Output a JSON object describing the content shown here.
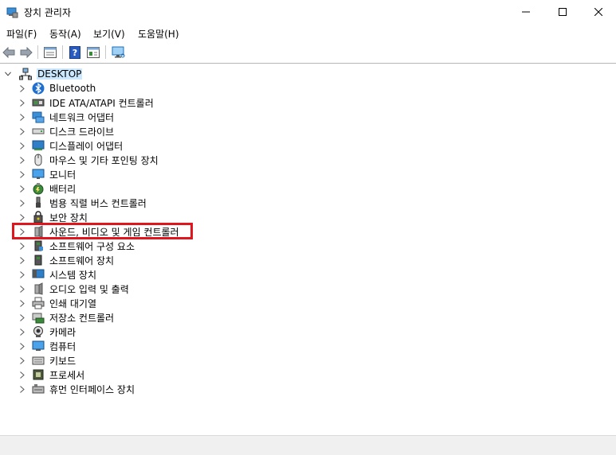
{
  "window": {
    "title": "장치 관리자"
  },
  "menu": {
    "file": "파일(F)",
    "action": "동작(A)",
    "view": "보기(V)",
    "help": "도움말(H)"
  },
  "tree": {
    "root": "DESKTOP",
    "items": [
      {
        "label": "Bluetooth",
        "icon": "bluetooth-icon"
      },
      {
        "label": "IDE ATA/ATAPI 컨트롤러",
        "icon": "ide-controller-icon"
      },
      {
        "label": "네트워크 어댑터",
        "icon": "network-adapter-icon"
      },
      {
        "label": "디스크 드라이브",
        "icon": "disk-drive-icon"
      },
      {
        "label": "디스플레이 어댑터",
        "icon": "display-adapter-icon"
      },
      {
        "label": "마우스 및 기타 포인팅 장치",
        "icon": "mouse-icon"
      },
      {
        "label": "모니터",
        "icon": "monitor-icon"
      },
      {
        "label": "배터리",
        "icon": "battery-icon"
      },
      {
        "label": "범용 직렬 버스 컨트롤러",
        "icon": "usb-icon"
      },
      {
        "label": "보안 장치",
        "icon": "security-device-icon"
      },
      {
        "label": "사운드, 비디오 및 게임 컨트롤러",
        "icon": "speaker-icon"
      },
      {
        "label": "소프트웨어 구성 요소",
        "icon": "software-component-icon"
      },
      {
        "label": "소프트웨어 장치",
        "icon": "software-device-icon"
      },
      {
        "label": "시스템 장치",
        "icon": "system-device-icon"
      },
      {
        "label": "오디오 입력 및 출력",
        "icon": "audio-io-icon"
      },
      {
        "label": "인쇄 대기열",
        "icon": "printer-icon"
      },
      {
        "label": "저장소 컨트롤러",
        "icon": "storage-controller-icon"
      },
      {
        "label": "카메라",
        "icon": "camera-icon"
      },
      {
        "label": "컴퓨터",
        "icon": "computer-icon"
      },
      {
        "label": "키보드",
        "icon": "keyboard-icon"
      },
      {
        "label": "프로세서",
        "icon": "processor-icon"
      },
      {
        "label": "휴먼 인터페이스 장치",
        "icon": "hid-icon"
      }
    ]
  },
  "colors": {
    "highlight_box": "#e0161e",
    "root_selection": "#cce8ff"
  }
}
